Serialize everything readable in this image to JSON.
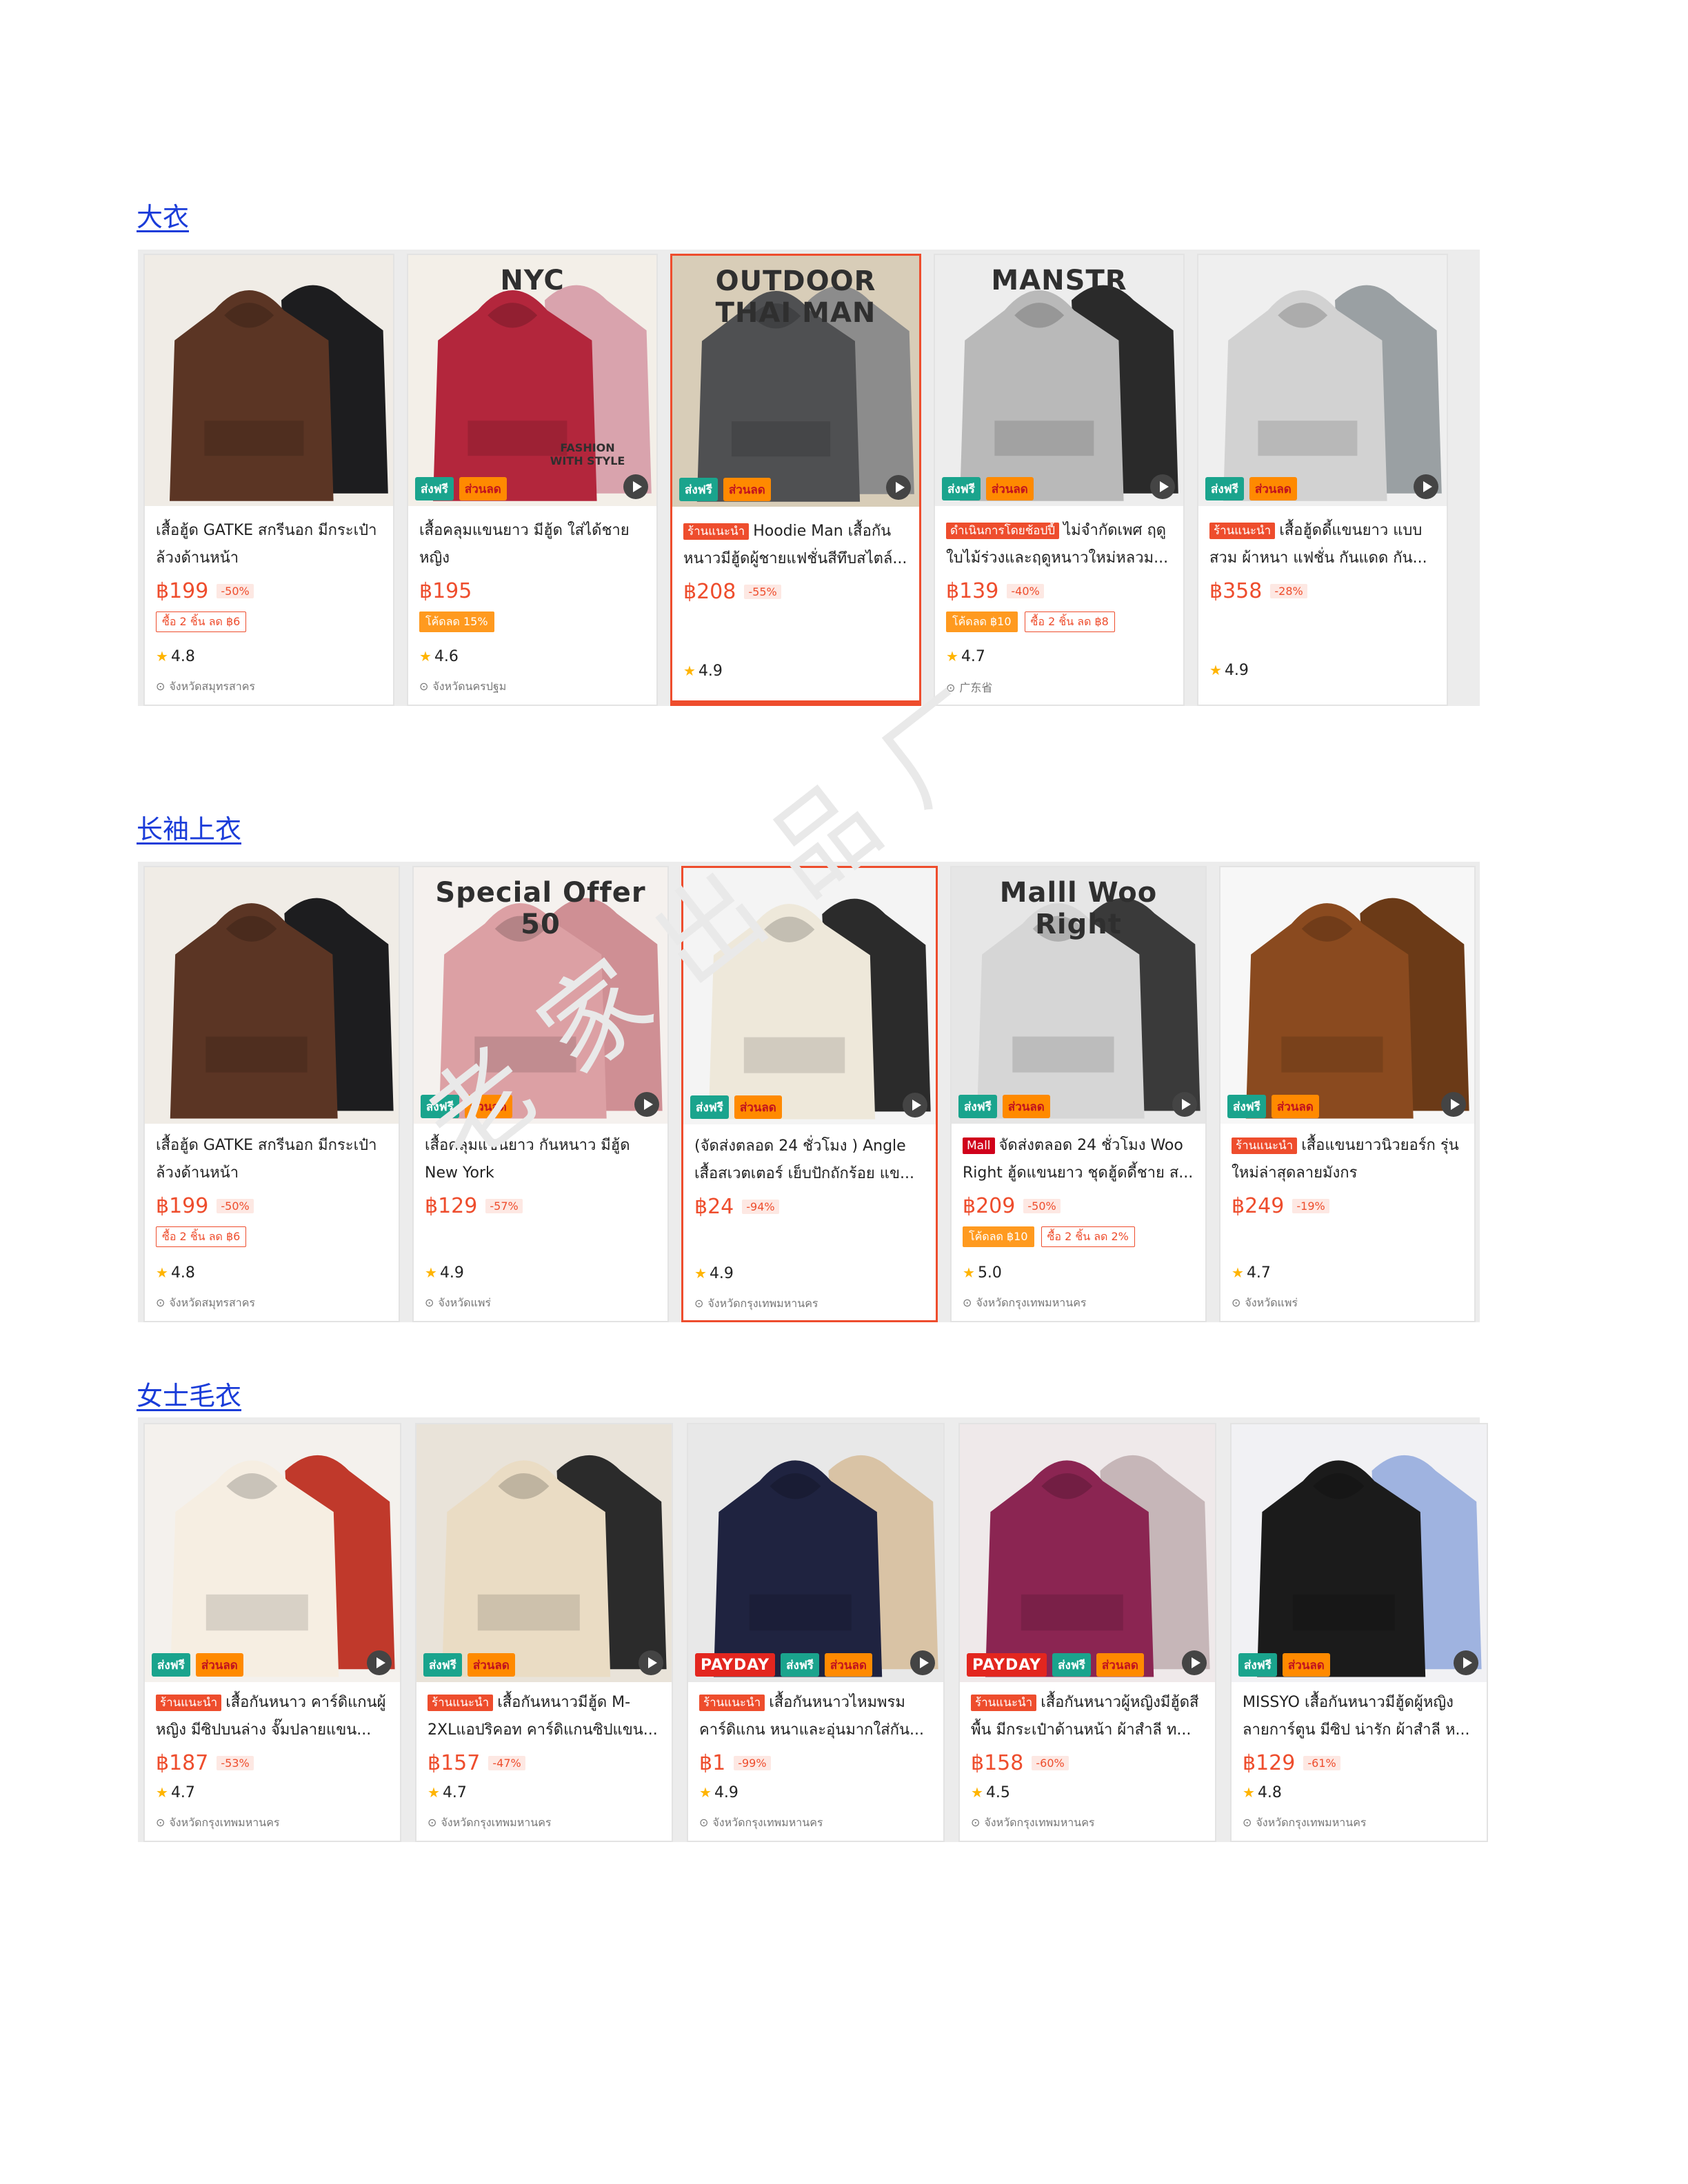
{
  "sections": [
    {
      "title": "大衣",
      "cards": [
        {
          "name": "เสื้อฮู้ด GATKE สกรีนอก มีกระเป๋าล้วงด้านหน้า",
          "price": "฿199",
          "off": "-50%",
          "vouchers": [
            {
              "text": "ซื้อ 2 ชิ้น ลด ฿6",
              "style": "outline"
            }
          ],
          "rating": "4.8",
          "location": "จังหวัดสมุทรสาคร",
          "tag": "",
          "badges": []
        },
        {
          "name": "เสื้อคลุมแขนยาว มีฮู้ด ใส่ได้ชายหญิง",
          "price": "฿195",
          "off": "",
          "vouchers": [
            {
              "text": "โค้ดลด 15%",
              "style": "fill"
            }
          ],
          "rating": "4.6",
          "location": "จังหวัดนครปฐม",
          "tag": "",
          "badges": [
            "ส่งฟรี",
            "ส่วนลด"
          ],
          "overlay": "NYC",
          "overlay2": "FASHION WITH STYLE"
        },
        {
          "name": "Hoodie Man เสื้อกันหนาวมีฮู้ดผู้ชายแฟชั่นสีทึบสไตล์...",
          "price": "฿208",
          "off": "-55%",
          "vouchers": [],
          "rating": "4.9",
          "location": "",
          "tag": "ร้านแนะนำ",
          "badges": [
            "ส่งฟรี",
            "ส่วนลด"
          ],
          "overlay": "OUTDOOR THAI MAN"
        },
        {
          "name": "ไม่จำกัดเพศ ฤดูใบไม้ร่วงและฤดูหนาวใหม่หลวม...",
          "price": "฿139",
          "off": "-40%",
          "vouchers": [
            {
              "text": "โค้ดลด ฿10",
              "style": "fill"
            },
            {
              "text": "ซื้อ 2 ชิ้น ลด ฿8",
              "style": "outline"
            }
          ],
          "rating": "4.7",
          "location": "广东省",
          "tag": "ดำเนินการโดยช้อปปี้",
          "badges": [
            "ส่งฟรี",
            "ส่วนลด"
          ],
          "overlay": "MANSTR"
        },
        {
          "name": "เสื้อฮู้ดดี้แขนยาว แบบสวม ผ้าหนา แฟชั่น กันแดด กัน...",
          "price": "฿358",
          "off": "-28%",
          "vouchers": [],
          "rating": "4.9",
          "location": "",
          "tag": "ร้านแนะนำ",
          "badges": [
            "ส่งฟรี",
            "ส่วนลด"
          ]
        }
      ]
    },
    {
      "title": "长袖上衣",
      "cards": [
        {
          "name": "เสื้อฮู้ด GATKE สกรีนอก มีกระเป๋าล้วงด้านหน้า",
          "price": "฿199",
          "off": "-50%",
          "vouchers": [
            {
              "text": "ซื้อ 2 ชิ้น ลด ฿6",
              "style": "outline"
            }
          ],
          "rating": "4.8",
          "location": "จังหวัดสมุทรสาคร",
          "tag": "",
          "badges": []
        },
        {
          "name": "เสื้อคลุมแขนยาว กันหนาว มีฮู้ด New York",
          "price": "฿129",
          "off": "-57%",
          "vouchers": [],
          "rating": "4.9",
          "location": "จังหวัดแพร่",
          "tag": "",
          "badges": [
            "ส่งฟรี",
            "ส่วนลด"
          ],
          "overlay": "Special Offer 50"
        },
        {
          "name": "(จัดส่งตลอด 24 ชั่วโมง ) Angle เสื้อสเวตเตอร์ เย็บปักถักร้อย แข...",
          "price": "฿24",
          "off": "-94%",
          "vouchers": [],
          "rating": "4.9",
          "location": "จังหวัดกรุงเทพมหานคร",
          "tag": "",
          "badges": [
            "ส่งฟรี",
            "ส่วนลด"
          ]
        },
        {
          "name": "จัดส่งตลอด 24 ชั่วโมง Woo Right ฮู้ดแขนยาว ชุดฮู้ดดี้ชาย ส...",
          "price": "฿209",
          "off": "-50%",
          "vouchers": [
            {
              "text": "โค้ดลด ฿10",
              "style": "fill"
            },
            {
              "text": "ซื้อ 2 ชิ้น ลด 2%",
              "style": "outline"
            }
          ],
          "rating": "5.0",
          "location": "จังหวัดกรุงเทพมหานคร",
          "tag": "Mall",
          "badges": [
            "ส่งฟรี",
            "ส่วนลด"
          ],
          "overlay": "Malll Woo Right"
        },
        {
          "name": "เสื้อแขนยาวนิวยอร์ก รุ่นใหม่ล่าสุดลายมังกร",
          "price": "฿249",
          "off": "-19%",
          "vouchers": [],
          "rating": "4.7",
          "location": "จังหวัดแพร่",
          "tag": "ร้านแนะนำ",
          "badges": [
            "ส่งฟรี",
            "ส่วนลด"
          ]
        }
      ]
    },
    {
      "title": "女士毛衣",
      "cards": [
        {
          "name": "เสื้อกันหนาว คาร์ดิแกนผู้หญิง มีซิปบนล่าง จั๊มปลายแขน...",
          "price": "฿187",
          "off": "-53%",
          "vouchers": [],
          "rating": "4.7",
          "location": "จังหวัดกรุงเทพมหานคร",
          "tag": "ร้านแนะนำ",
          "badges": [
            "ส่งฟรี",
            "ส่วนลด"
          ]
        },
        {
          "name": "เสื้อกันหนาวมีฮู้ด M-2XLแอปริคอท คาร์ดิแกนซิปแขน...",
          "price": "฿157",
          "off": "-47%",
          "vouchers": [],
          "rating": "4.7",
          "location": "จังหวัดกรุงเทพมหานคร",
          "tag": "ร้านแนะนำ",
          "badges": [
            "ส่งฟรี",
            "ส่วนลด"
          ]
        },
        {
          "name": "เสื้อกันหนาวไหมพรมคาร์ดิแกน หนาและอุ่นมากใส่กัน...",
          "price": "฿1",
          "off": "-99%",
          "vouchers": [],
          "rating": "4.9",
          "location": "จังหวัดกรุงเทพมหานคร",
          "tag": "ร้านแนะนำ",
          "badges": [
            "PAYDAY",
            "ส่งฟรี",
            "ส่วนลด"
          ]
        },
        {
          "name": "เสื้อกันหนาวผู้หญิงมีฮู้ดสีพื้น มีกระเป๋าด้านหน้า ผ้าสำลี ท...",
          "price": "฿158",
          "off": "-60%",
          "vouchers": [],
          "rating": "4.5",
          "location": "จังหวัดกรุงเทพมหานคร",
          "tag": "ร้านแนะนำ",
          "badges": [
            "PAYDAY",
            "ส่งฟรี",
            "ส่วนลด"
          ]
        },
        {
          "name": "MISSYO เสื้อกันหนาวมีฮู้ดผู้หญิงลายการ์ตูน มีซิป น่ารัก ผ้าสำลี ห...",
          "price": "฿129",
          "off": "-61%",
          "vouchers": [],
          "rating": "4.8",
          "location": "จังหวัดกรุงเทพมหานคร",
          "tag": "",
          "badges": [
            "ส่งฟรี",
            "ส่วนลด"
          ]
        }
      ]
    }
  ],
  "watermark": "老家出品厂",
  "colors": {
    "accent": "#ee4d2d",
    "link": "#1a3cd9",
    "free_ship": "#1aa48d",
    "discount": "#ff8a00"
  },
  "icons": {
    "rating": "star-icon",
    "location": "pin-icon",
    "video": "play-icon"
  }
}
